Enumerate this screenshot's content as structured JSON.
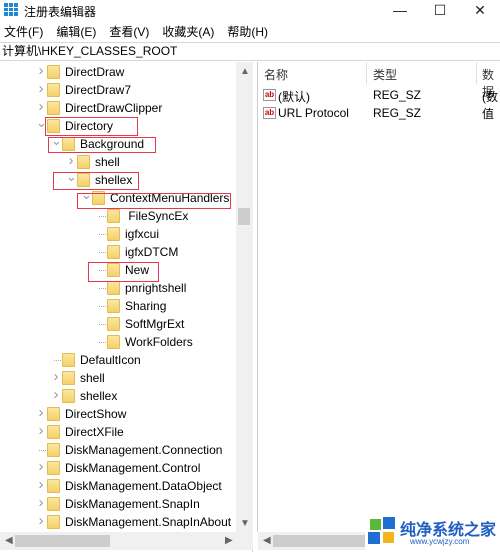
{
  "window": {
    "title": "注册表编辑器",
    "minimize": "—",
    "maximize": "☐",
    "close": "✕"
  },
  "menu": [
    "文件(F)",
    "编辑(E)",
    "查看(V)",
    "收藏夹(A)",
    "帮助(H)"
  ],
  "address": "计算机\\HKEY_CLASSES_ROOT",
  "tree": [
    {
      "label": "DirectDraw",
      "level": 0,
      "state": "collapsed"
    },
    {
      "label": "DirectDraw7",
      "level": 0,
      "state": "collapsed"
    },
    {
      "label": "DirectDrawClipper",
      "level": 0,
      "state": "collapsed"
    },
    {
      "label": "Directory",
      "level": 0,
      "state": "expanded",
      "highlight": true
    },
    {
      "label": "Background",
      "level": 1,
      "state": "expanded",
      "highlight": true
    },
    {
      "label": "shell",
      "level": 2,
      "state": "collapsed"
    },
    {
      "label": "shellex",
      "level": 2,
      "state": "expanded",
      "highlight": true
    },
    {
      "label": "ContextMenuHandlers",
      "level": 3,
      "state": "expanded",
      "highlight": true
    },
    {
      "label": " FileSyncEx",
      "level": 4,
      "state": "leaf"
    },
    {
      "label": "igfxcui",
      "level": 4,
      "state": "leaf"
    },
    {
      "label": "igfxDTCM",
      "level": 4,
      "state": "leaf"
    },
    {
      "label": "New",
      "level": 4,
      "state": "leaf",
      "highlight": true
    },
    {
      "label": "pnrightshell",
      "level": 4,
      "state": "leaf"
    },
    {
      "label": "Sharing",
      "level": 4,
      "state": "leaf"
    },
    {
      "label": "SoftMgrExt",
      "level": 4,
      "state": "leaf"
    },
    {
      "label": "WorkFolders",
      "level": 4,
      "state": "leaf"
    },
    {
      "label": "DefaultIcon",
      "level": 1,
      "state": "leaf"
    },
    {
      "label": "shell",
      "level": 1,
      "state": "collapsed"
    },
    {
      "label": "shellex",
      "level": 1,
      "state": "collapsed"
    },
    {
      "label": "DirectShow",
      "level": 0,
      "state": "collapsed"
    },
    {
      "label": "DirectXFile",
      "level": 0,
      "state": "collapsed"
    },
    {
      "label": "DiskManagement.Connection",
      "level": 0,
      "state": "leaf"
    },
    {
      "label": "DiskManagement.Control",
      "level": 0,
      "state": "collapsed"
    },
    {
      "label": "DiskManagement.DataObject",
      "level": 0,
      "state": "collapsed"
    },
    {
      "label": "DiskManagement.SnapIn",
      "level": 0,
      "state": "collapsed"
    },
    {
      "label": "DiskManagement.SnapInAbout",
      "level": 0,
      "state": "collapsed"
    }
  ],
  "values": {
    "headers": [
      "名称",
      "类型",
      "数据"
    ],
    "rows": [
      {
        "name": "(默认)",
        "type": "REG_SZ",
        "data": "(数值"
      },
      {
        "name": "URL Protocol",
        "type": "REG_SZ",
        "data": ""
      }
    ]
  },
  "watermark": {
    "text": "纯净系统之家",
    "url": "www.ycwjzy.com"
  },
  "colors": {
    "highlight": "#e8364a",
    "folder": "#f5d06a"
  }
}
